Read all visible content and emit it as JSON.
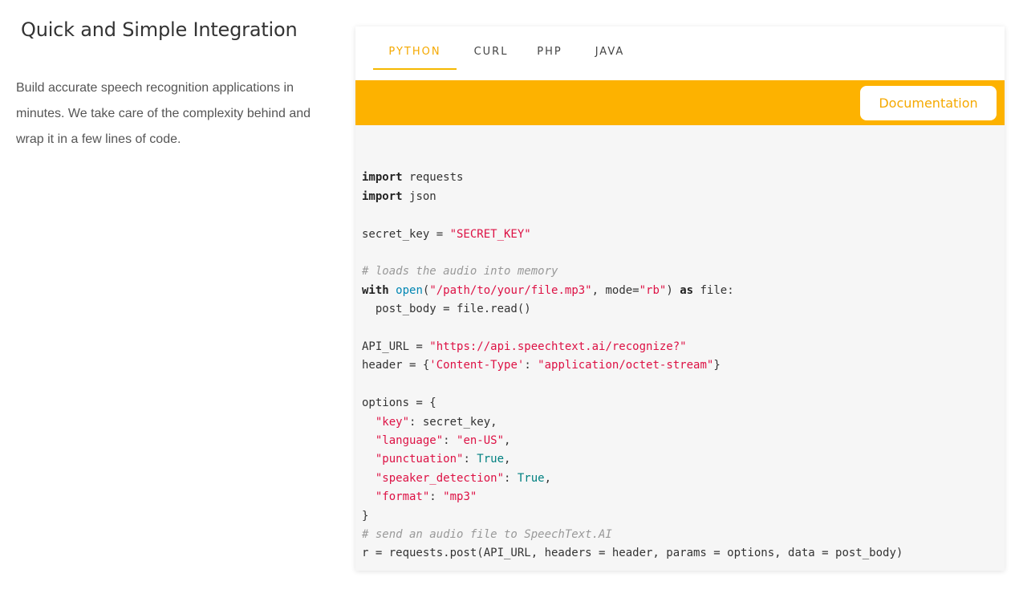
{
  "intro": {
    "title": "Quick and Simple Integration",
    "description": "Build accurate speech recognition applications in minutes. We take care of the complexity behind and wrap it in a few lines of code."
  },
  "tabs": [
    {
      "label": "PYTHON",
      "active": true
    },
    {
      "label": "CURL",
      "active": false
    },
    {
      "label": "PHP",
      "active": false
    },
    {
      "label": "JAVA",
      "active": false
    }
  ],
  "documentation_button": "Documentation",
  "colors": {
    "accent": "#fdb200",
    "string": "#dd1144",
    "builtin": "#0086b3",
    "comment": "#999999"
  },
  "code_lines": [
    [],
    [
      [
        "kw",
        "import"
      ],
      [
        "",
        "requests"
      ]
    ],
    [
      [
        "kw",
        "import"
      ],
      [
        "",
        "json"
      ]
    ],
    [],
    [
      [
        "",
        "secret_key = "
      ],
      [
        "str",
        "\"SECRET_KEY\""
      ]
    ],
    [],
    [
      [
        "cm",
        "# loads the audio into memory"
      ]
    ],
    [
      [
        "kw",
        "with"
      ],
      [
        "",
        ""
      ],
      [
        "fn",
        "open"
      ],
      [
        "",
        "("
      ],
      [
        "str",
        "\"/path/to/your/file.mp3\""
      ],
      [
        "",
        ", mode="
      ],
      [
        "str",
        "\"rb\""
      ],
      [
        "",
        ") "
      ],
      [
        "kw",
        "as"
      ],
      [
        "",
        ""
      ],
      [
        "",
        "file:"
      ]
    ],
    [
      [
        "",
        "  post_body = file.read()"
      ]
    ],
    [],
    [
      [
        "",
        "API_URL = "
      ],
      [
        "str",
        "\"https://api.speechtext.ai/recognize?\""
      ]
    ],
    [
      [
        "",
        "header = {"
      ],
      [
        "str",
        "'Content-Type'"
      ],
      [
        "",
        ": "
      ],
      [
        "str",
        "\"application/octet-stream\""
      ],
      [
        "",
        "}"
      ]
    ],
    [],
    [
      [
        "",
        "options = {"
      ]
    ],
    [
      [
        "",
        "  "
      ],
      [
        "str",
        "\"key\""
      ],
      [
        "",
        ": secret_key,"
      ]
    ],
    [
      [
        "",
        "  "
      ],
      [
        "str",
        "\"language\""
      ],
      [
        "",
        ": "
      ],
      [
        "str",
        "\"en-US\""
      ],
      [
        "",
        ","
      ]
    ],
    [
      [
        "",
        "  "
      ],
      [
        "str",
        "\"punctuation\""
      ],
      [
        "",
        ": "
      ],
      [
        "bool",
        "True"
      ],
      [
        "",
        ","
      ]
    ],
    [
      [
        "",
        "  "
      ],
      [
        "str",
        "\"speaker_detection\""
      ],
      [
        "",
        ": "
      ],
      [
        "bool",
        "True"
      ],
      [
        "",
        ","
      ]
    ],
    [
      [
        "",
        "  "
      ],
      [
        "str",
        "\"format\""
      ],
      [
        "",
        ": "
      ],
      [
        "str",
        "\"mp3\""
      ]
    ],
    [
      [
        "",
        "}"
      ]
    ],
    [
      [
        "cm",
        "# send an audio file to SpeechText.AI"
      ]
    ],
    [
      [
        "",
        "r = requests.post(API_URL, headers = header, params = options, data = post_body)"
      ]
    ]
  ]
}
